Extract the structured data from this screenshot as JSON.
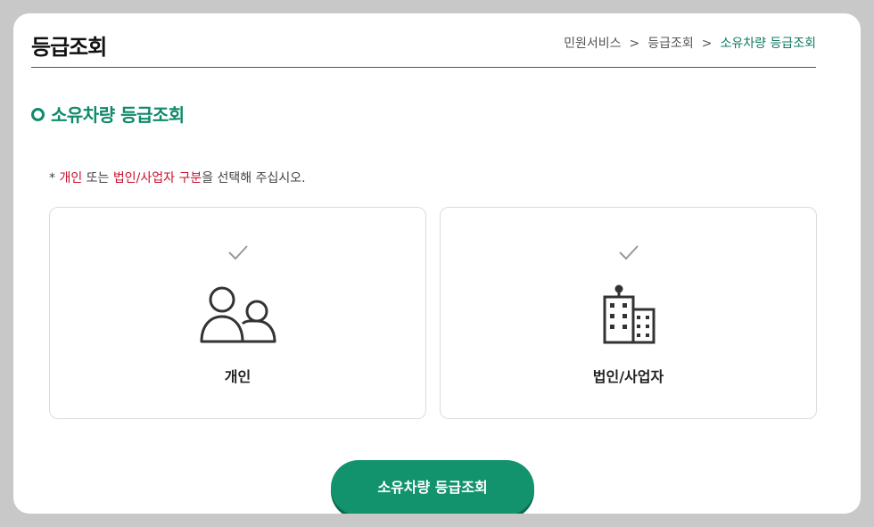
{
  "page": {
    "title": "등급조회"
  },
  "breadcrumb": {
    "items": [
      "민원서비스",
      "등급조회",
      "소유차량 등급조회"
    ],
    "separator": ">"
  },
  "section": {
    "title": "소유차량 등급조회"
  },
  "notice": {
    "prefix": "* ",
    "individual": "개인",
    "mid": " 또는 ",
    "corporate": "법인/사업자 구분",
    "suffix": "을 선택해 주십시오."
  },
  "options": [
    {
      "label": "개인",
      "icon": "people-icon"
    },
    {
      "label": "법인/사업자",
      "icon": "building-icon"
    }
  ],
  "submit": {
    "label": "소유차량 등급조회"
  },
  "colors": {
    "accent": "#12936d",
    "highlight": "#c8102e",
    "background": "#c8c8c8"
  }
}
